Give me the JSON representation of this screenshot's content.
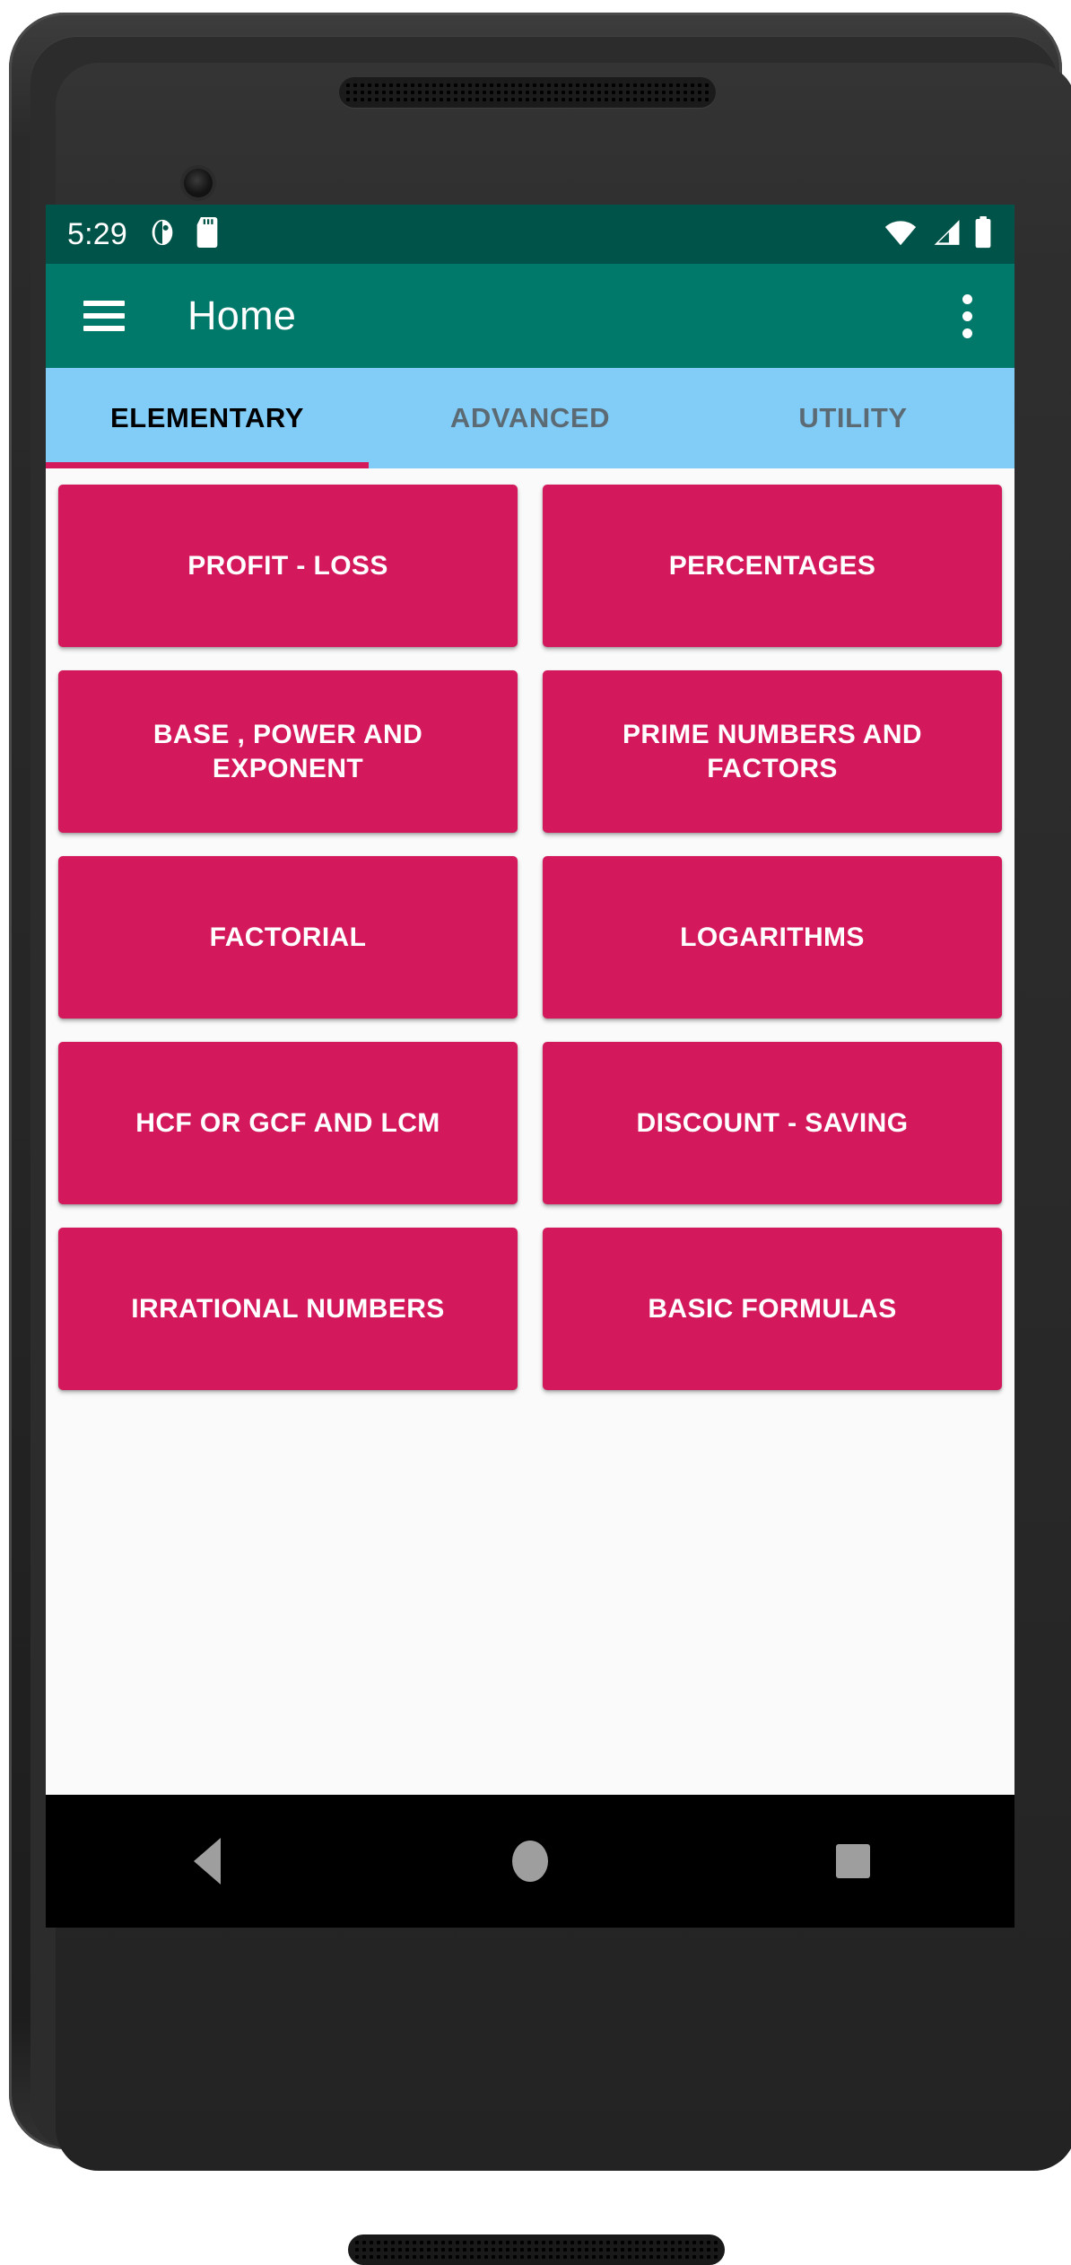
{
  "device": {
    "earpiece_icon": "speaker-grille",
    "camera_icon": "front-camera"
  },
  "status_bar": {
    "time": "5:29",
    "left_icons": [
      "app-notification-icon",
      "sd-card-icon"
    ],
    "right_icons": [
      "wifi-icon",
      "cellular-signal-icon",
      "battery-icon"
    ],
    "background": "#005348"
  },
  "app_bar": {
    "menu_icon": "hamburger-menu-icon",
    "title": "Home",
    "overflow_icon": "overflow-menu-icon",
    "background": "#00796B"
  },
  "tabs": {
    "background": "#82CCF8",
    "active_index": 0,
    "indicator_color": "#D3195C",
    "items": [
      {
        "label": "ELEMENTARY"
      },
      {
        "label": "ADVANCED"
      },
      {
        "label": "UTILITY"
      }
    ]
  },
  "content": {
    "background": "#fafafa",
    "card_color": "#D3195C",
    "card_text_color": "#ffffff",
    "topics": [
      {
        "label": "PROFIT - LOSS"
      },
      {
        "label": "PERCENTAGES"
      },
      {
        "label": "BASE , POWER AND EXPONENT"
      },
      {
        "label": "PRIME NUMBERS AND FACTORS"
      },
      {
        "label": "FACTORIAL"
      },
      {
        "label": "LOGARITHMS"
      },
      {
        "label": "HCF OR GCF AND LCM"
      },
      {
        "label": "DISCOUNT - SAVING"
      },
      {
        "label": "IRRATIONAL NUMBERS"
      },
      {
        "label": "BASIC FORMULAS"
      }
    ]
  },
  "nav_bar": {
    "background": "#000000",
    "buttons": [
      {
        "icon": "back-triangle-icon"
      },
      {
        "icon": "home-circle-icon"
      },
      {
        "icon": "recents-square-icon"
      }
    ]
  }
}
